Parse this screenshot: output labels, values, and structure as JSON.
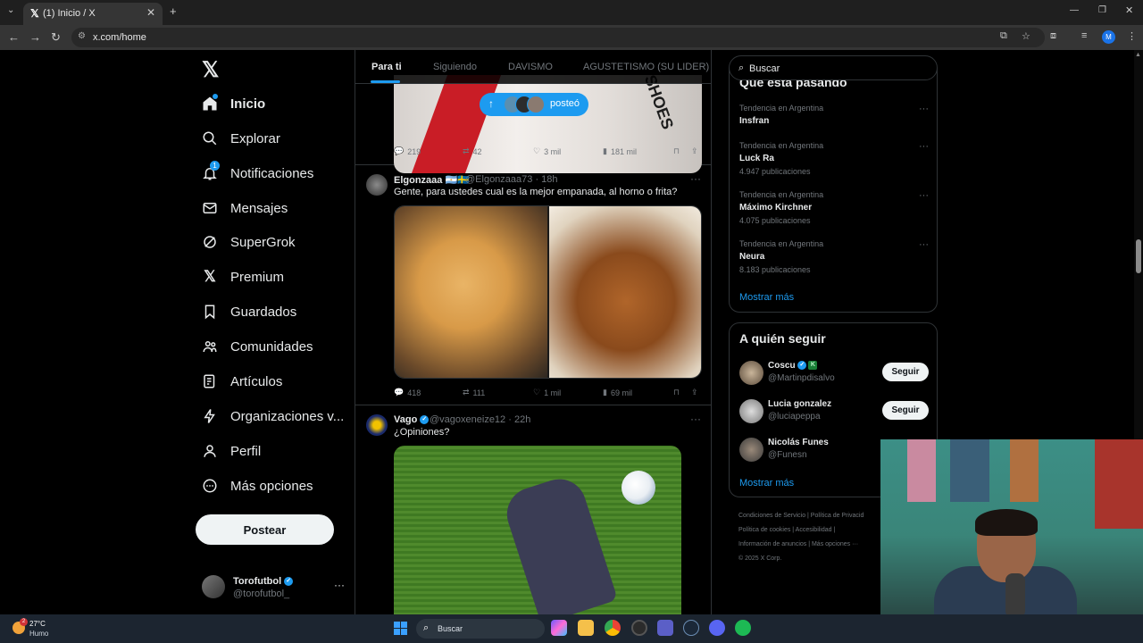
{
  "browser": {
    "tab_title": "(1) Inicio / X",
    "url": "x.com/home"
  },
  "leftnav": {
    "items": [
      {
        "label": "Inicio",
        "icon": "home-icon"
      },
      {
        "label": "Explorar",
        "icon": "search-icon"
      },
      {
        "label": "Notificaciones",
        "icon": "bell-icon",
        "badge": "1"
      },
      {
        "label": "Mensajes",
        "icon": "envelope-icon"
      },
      {
        "label": "SuperGrok",
        "icon": "grok-icon"
      },
      {
        "label": "Premium",
        "icon": "x-icon"
      },
      {
        "label": "Guardados",
        "icon": "bookmark-icon"
      },
      {
        "label": "Comunidades",
        "icon": "people-icon"
      },
      {
        "label": "Artículos",
        "icon": "article-icon"
      },
      {
        "label": "Organizaciones v...",
        "icon": "lightning-icon"
      },
      {
        "label": "Perfil",
        "icon": "person-icon"
      },
      {
        "label": "Más opciones",
        "icon": "more-circle-icon"
      }
    ],
    "post_button": "Postear",
    "profile": {
      "name": "Torofutbol",
      "handle": "@torofutbol_"
    }
  },
  "timeline": {
    "tabs": [
      "Para ti",
      "Siguiendo",
      "DAVISMO",
      "AGUSTETISMO (SU LIDER)"
    ],
    "posted_pill": "posteó",
    "posts": [
      {
        "image_text": "SHOES",
        "metrics": {
          "replies": "219",
          "reposts": "42",
          "likes": "3 mil",
          "views": "181 mil"
        }
      },
      {
        "name": "Elgonzaaa",
        "flags": "🇦🇷🇸🇪",
        "handle": "@Elgonzaaa73",
        "time": "· 18h",
        "text": "Gente, para ustedes cual es la mejor empanada, al horno o frita?",
        "metrics": {
          "replies": "418",
          "reposts": "111",
          "likes": "1 mil",
          "views": "69 mil"
        }
      },
      {
        "name": "Vago",
        "handle": "@vagoxeneize12",
        "time": "· 22h",
        "text": "¿Opiniones?"
      }
    ]
  },
  "right": {
    "search_placeholder": "Buscar",
    "trends_heading": "Qué está pasando",
    "trends": [
      {
        "meta": "Tendencia en Argentina",
        "name": "Insfran",
        "count": ""
      },
      {
        "meta": "Tendencia en Argentina",
        "name": "Luck Ra",
        "count": "4.947 publicaciones"
      },
      {
        "meta": "Tendencia en Argentina",
        "name": "Máximo Kirchner",
        "count": "4.075 publicaciones"
      },
      {
        "meta": "Tendencia en Argentina",
        "name": "Neura",
        "count": "8.183 publicaciones"
      }
    ],
    "trends_more": "Mostrar más",
    "follow_heading": "A quién seguir",
    "follow": [
      {
        "name": "Coscu",
        "handle": "@Martinpdisalvo",
        "button": "Seguir"
      },
      {
        "name": "Lucia gonzalez",
        "handle": "@luciapeppa",
        "button": "Seguir"
      },
      {
        "name": "Nicolás Funes",
        "handle": "@Funesn",
        "button": ""
      }
    ],
    "follow_more": "Mostrar más",
    "footer": {
      "line1": "Condiciones de Servicio  |  Política de Privacid",
      "line2": "Política de cookies  |  Accesibilidad  |",
      "line3": "Información de anuncios  |  Más opciones ···",
      "line4": "© 2025 X Corp."
    }
  },
  "taskbar": {
    "temp": "27°C",
    "condition": "Humo",
    "weather_badge": "2",
    "search_label": "Buscar"
  },
  "colors": {
    "accent": "#1d9bf0",
    "background": "#000000",
    "border": "#2f3336"
  }
}
